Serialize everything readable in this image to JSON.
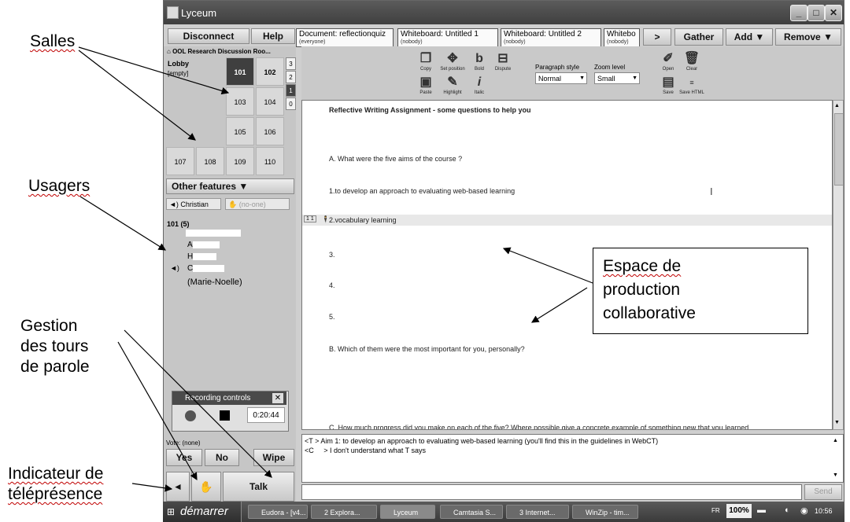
{
  "annotations": {
    "salles": "Salles",
    "usagers": "Usagers",
    "gestion": [
      "Gestion",
      "des tours",
      "de parole"
    ],
    "indicateur": [
      "Indicateur de",
      "téléprésence"
    ],
    "espace": [
      "Espace de",
      "production",
      "collaborative"
    ]
  },
  "window": {
    "title": "Lyceum"
  },
  "toolbar": {
    "disconnect": "Disconnect",
    "help": "Help",
    "gather": "Gather",
    "add": "Add ▼",
    "remove": "Remove ▼",
    "next": ">"
  },
  "tabs": [
    {
      "title": "Document: reflectionquiz",
      "sub": "(everyone)"
    },
    {
      "title": "Whiteboard: Untitled 1",
      "sub": "(nobody)"
    },
    {
      "title": "Whiteboard: Untitled 2",
      "sub": "(nobody)"
    },
    {
      "title": "Whitebo",
      "sub": "(nobody)"
    }
  ],
  "rooms": {
    "building": "OOL Research Discussion Roo...",
    "lobby": "Lobby",
    "lobby_status": "[empty]",
    "names": [
      "101",
      "102",
      "103",
      "104",
      "105",
      "106",
      "107",
      "108",
      "109",
      "110"
    ],
    "floors": [
      "3",
      "2",
      "1",
      "0"
    ]
  },
  "other_features": "Other features ▼",
  "speakers": {
    "speaking": "Christian",
    "hand": "(no-one)"
  },
  "users": {
    "room": "101 (5)",
    "names": [
      "A",
      "H",
      "C",
      "(Marie-Noelle)"
    ]
  },
  "recording": {
    "title": "Recording controls",
    "time": "0:20:44"
  },
  "vote": {
    "label": "Vote: (none)",
    "yes": "Yes",
    "no": "No",
    "wipe": "Wipe"
  },
  "talk": "Talk",
  "editor_tools": {
    "items": [
      "Copy",
      "Set position",
      "Bold",
      "Dispute",
      "Paste",
      "Highlight",
      "Italic"
    ],
    "paragraph_label": "Paragraph style",
    "paragraph_value": "Normal",
    "zoom_label": "Zoom level",
    "zoom_value": "Small",
    "open": "Open",
    "clear": "Clear",
    "save": "Save",
    "save_html": "Save HTML"
  },
  "document": {
    "heading": "Reflective Writing Assignment - some questions to help you",
    "a": "A. What were the five aims of the course ?",
    "a1": "1.to develop an approach to evaluating web-based learning",
    "a2": "2.vocabulary learning",
    "a3": "3.",
    "a4": "4.",
    "a5": "5.",
    "b": "B. Which of them were the most important for you, personally?",
    "c": "C. How much progress did you make on each of the five? Where possible give a concrete example of something new that you learned"
  },
  "chat": [
    {
      "who": "<T",
      "msg": "> Aim 1: to develop an approach to evaluating web-based learning (you'll find this in the guidelines in WebCT)"
    },
    {
      "who": "<C",
      "msg": "> I don't understand what T   says"
    }
  ],
  "send": "Send",
  "taskbar": {
    "start": "démarrer",
    "tasks": [
      "Eudora - [v4...",
      "2 Explora...",
      "Lyceum",
      "Camtasia S...",
      "3 Internet...",
      "WinZip - tim..."
    ],
    "lang": "FR",
    "zoom": "100%",
    "clock": "10:56"
  },
  "colors": {
    "callout_border": "#000000",
    "squiggle": "#c00000"
  }
}
